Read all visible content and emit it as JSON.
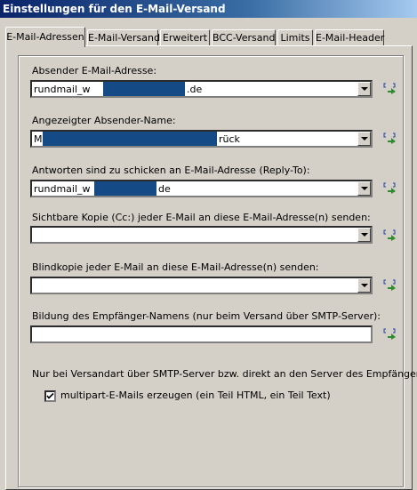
{
  "window": {
    "title": "Einstellungen für den E-Mail-Versand"
  },
  "tabs": [
    {
      "label": "E-Mail-Adressen"
    },
    {
      "label": "E-Mail-Versand"
    },
    {
      "label": "Erweitert"
    },
    {
      "label": "BCC-Versand"
    },
    {
      "label": "Limits"
    },
    {
      "label": "E-Mail-Header"
    }
  ],
  "fields": {
    "sender": {
      "label": "Absender E-Mail-Adresse:",
      "value_prefix": "rundmail_w",
      "value_suffix": ".de"
    },
    "display_name": {
      "label": "Angezeigter Absender-Name:",
      "value_prefix": "M.",
      "value_suffix": "rück"
    },
    "reply_to": {
      "label": "Antworten sind zu schicken an E-Mail-Adresse (Reply-To):",
      "value_prefix": "rundmail_w",
      "value_suffix": "de"
    },
    "cc": {
      "label": "Sichtbare Kopie (Cc:) jeder E-Mail an diese E-Mail-Adresse(n) senden:",
      "value": ""
    },
    "bcc": {
      "label": "Blindkopie jeder E-Mail an diese E-Mail-Adresse(n) senden:",
      "value": ""
    },
    "recipient_name": {
      "label": "Bildung des Empfänger-Namens (nur beim Versand über SMTP-Server):",
      "value": ""
    }
  },
  "smtp_note": "Nur bei Versandart über SMTP-Server bzw. direkt an den Server des Empfängers:",
  "multipart": {
    "label": "multipart-E-Mails erzeugen (ein Teil HTML, ein Teil Text)",
    "checked": true
  },
  "colors": {
    "redaction": "#144a86",
    "picker_arrow": "#2e8b2e",
    "picker_bracket": "#1f3fa8"
  }
}
